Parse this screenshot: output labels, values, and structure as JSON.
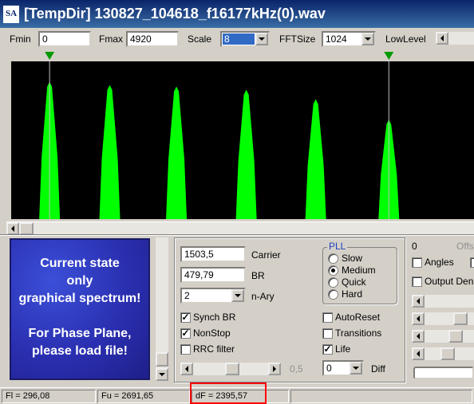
{
  "window": {
    "icon_text": "SA",
    "title": "[TempDir] 130827_104618_f16177kHz(0).wav"
  },
  "toolbar": {
    "fmin_label": "Fmin",
    "fmin_value": "0",
    "fmax_label": "Fmax",
    "fmax_value": "4920",
    "scale_label": "Scale",
    "scale_value": "8",
    "fftsize_label": "FFTSize",
    "fftsize_value": "1024",
    "lowlevel_label": "LowLevel"
  },
  "spectrum": {
    "background": "#000000",
    "trace_color": "#00ff00",
    "marker_color": "#009900",
    "peaks": [
      {
        "center": 0.083,
        "height": 0.87
      },
      {
        "center": 0.213,
        "height": 0.85
      },
      {
        "center": 0.357,
        "height": 0.84
      },
      {
        "center": 0.508,
        "height": 0.82
      },
      {
        "center": 0.658,
        "height": 0.76
      },
      {
        "center": 0.816,
        "height": 0.63
      }
    ],
    "marker_left": 0.083,
    "marker_right": 0.816
  },
  "state_panel": {
    "lines": [
      "Current state",
      "only",
      "graphical spectrum!",
      "",
      "For Phase Plane,",
      "please load file!"
    ],
    "background": "#2a2fb0"
  },
  "controls": {
    "carrier_value": "1503,5",
    "carrier_label": "Carrier",
    "br_value": "479,79",
    "br_label": "BR",
    "nary_value": "2",
    "nary_label": "n-Ary",
    "synch_br_label": "Synch BR",
    "synch_br_checked": true,
    "nonstop_label": "NonStop",
    "nonstop_checked": true,
    "rrc_label": "RRC filter",
    "rrc_checked": false,
    "slider_value": "0,5",
    "autoreset_label": "AutoReset",
    "autoreset_checked": false,
    "transitions_label": "Transitions",
    "transitions_checked": false,
    "life_label": "Life",
    "life_checked": true,
    "diff_value": "0",
    "diff_label": "Diff"
  },
  "pll": {
    "title": "PLL",
    "options": [
      "Slow",
      "Medium",
      "Quick",
      "Hard"
    ],
    "selected": "Medium"
  },
  "right_panel": {
    "zero_value": "0",
    "offs_label": "Offs",
    "angles_label": "Angles",
    "output_label": "Output Den"
  },
  "status": {
    "fl": "Fl = 296,08",
    "fu": "Fu = 2691,65",
    "df": "dF = 2395,57"
  }
}
